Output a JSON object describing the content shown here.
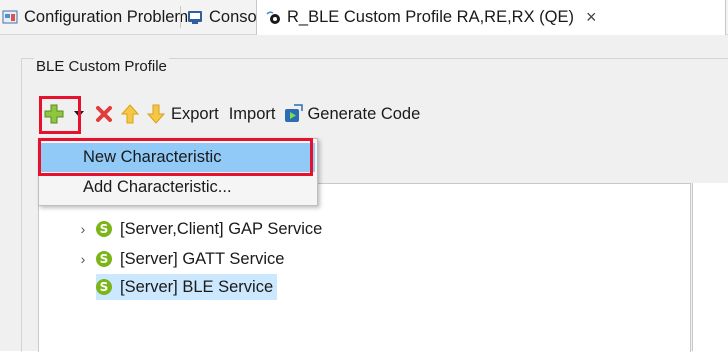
{
  "tabs": [
    {
      "label": "Configuration Problems",
      "icon": "configuration-problems-icon"
    },
    {
      "label": "Console",
      "icon": "console-icon"
    },
    {
      "label": "R_BLE Custom Profile RA,RE,RX (QE)",
      "icon": "qe-ble-profile-icon",
      "active": true
    }
  ],
  "close_symbol": "×",
  "group_title": "BLE Custom Profile",
  "toolbar": {
    "export_label": "Export",
    "import_label": "Import",
    "generate_label": "Generate Code"
  },
  "menu": {
    "items": [
      "New Characteristic",
      "Add Characteristic..."
    ],
    "highlighted": "New Characteristic"
  },
  "tree": {
    "items": [
      {
        "label": "[Server,Client] GAP Service",
        "expandable": true,
        "badge": "S"
      },
      {
        "label": "[Server] GATT Service",
        "expandable": true,
        "badge": "S"
      },
      {
        "label": "[Server] BLE Service",
        "expandable": false,
        "badge": "S",
        "selected": true
      }
    ]
  },
  "colors": {
    "highlight_box": "#e8112d",
    "menu_hover": "#91c9f7",
    "selection": "#cce8ff",
    "service_badge": "#7cb518"
  }
}
